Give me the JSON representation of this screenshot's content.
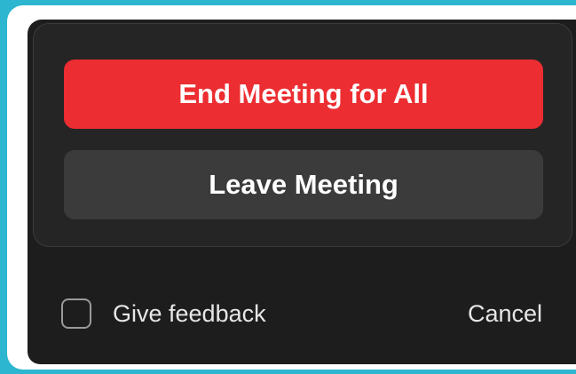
{
  "dialog": {
    "end_meeting_label": "End Meeting for All",
    "leave_meeting_label": "Leave Meeting",
    "give_feedback_label": "Give feedback",
    "give_feedback_checked": false,
    "cancel_label": "Cancel"
  },
  "colors": {
    "end_button": "#ec2d31",
    "leave_button": "#3b3b3b",
    "dialog_background": "#1d1d1d"
  }
}
